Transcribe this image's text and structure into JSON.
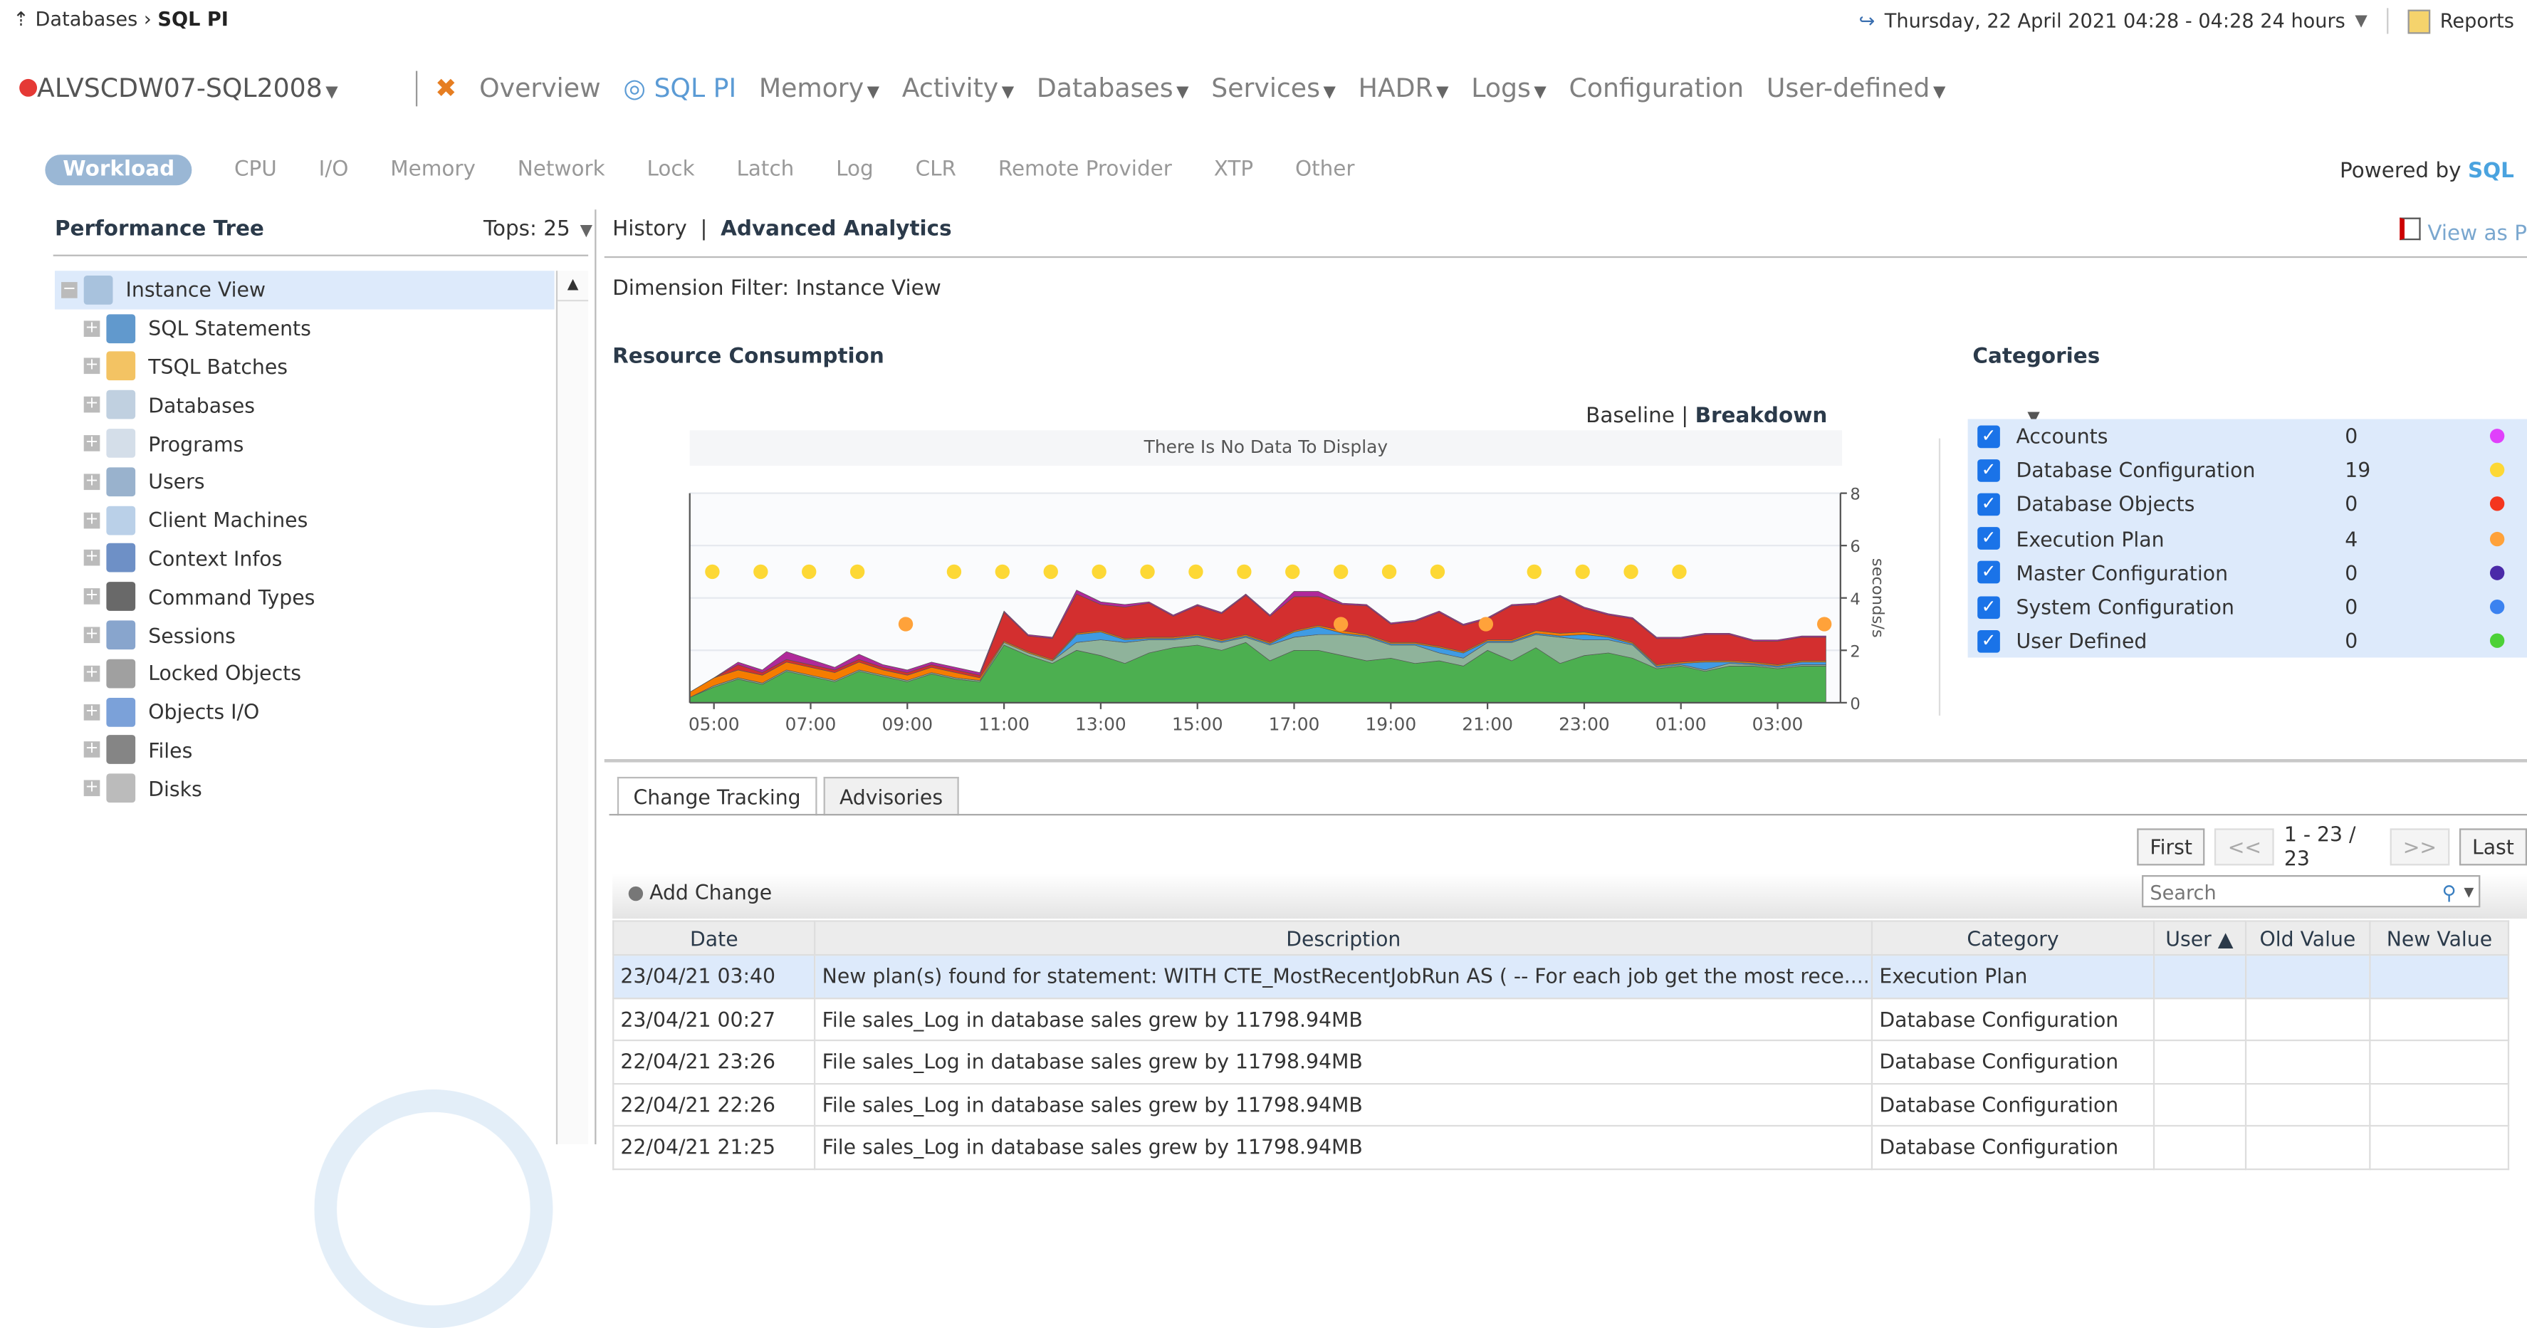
{
  "breadcrumb": {
    "parent": "Databases",
    "current": "SQL PI"
  },
  "time_range": "Thursday, 22 April 2021 04:28 - 04:28 24 hours",
  "reports_label": "Reports",
  "instance": {
    "name": "ALVSCDW07-SQL2008",
    "status": "error"
  },
  "nav": [
    {
      "label": "Overview",
      "caret": false
    },
    {
      "label": "SQL PI",
      "caret": false,
      "active": true
    },
    {
      "label": "Memory",
      "caret": true
    },
    {
      "label": "Activity",
      "caret": true
    },
    {
      "label": "Databases",
      "caret": true
    },
    {
      "label": "Services",
      "caret": true
    },
    {
      "label": "HADR",
      "caret": true
    },
    {
      "label": "Logs",
      "caret": true
    },
    {
      "label": "Configuration",
      "caret": false
    },
    {
      "label": "User-defined",
      "caret": true
    }
  ],
  "subnav": [
    "Workload",
    "CPU",
    "I/O",
    "Memory",
    "Network",
    "Lock",
    "Latch",
    "Log",
    "CLR",
    "Remote Provider",
    "XTP",
    "Other"
  ],
  "subnav_active": "Workload",
  "powered_by": {
    "prefix": "Powered by",
    "brand": "SQL"
  },
  "tree": {
    "title": "Performance Tree",
    "tops_label": "Tops:",
    "tops_value": "25",
    "items": [
      {
        "label": "Instance View",
        "icon": "instance-icon",
        "expanded": true
      },
      {
        "label": "SQL Statements",
        "icon": "sql-icon"
      },
      {
        "label": "TSQL Batches",
        "icon": "batches-icon"
      },
      {
        "label": "Databases",
        "icon": "database-icon"
      },
      {
        "label": "Programs",
        "icon": "programs-icon"
      },
      {
        "label": "Users",
        "icon": "users-icon"
      },
      {
        "label": "Client Machines",
        "icon": "client-machine-icon"
      },
      {
        "label": "Context Infos",
        "icon": "context-icon"
      },
      {
        "label": "Command Types",
        "icon": "command-icon"
      },
      {
        "label": "Sessions",
        "icon": "sessions-icon"
      },
      {
        "label": "Locked Objects",
        "icon": "lock-icon"
      },
      {
        "label": "Objects I/O",
        "icon": "objects-io-icon"
      },
      {
        "label": "Files",
        "icon": "files-icon"
      },
      {
        "label": "Disks",
        "icon": "disks-icon"
      }
    ]
  },
  "right_header": {
    "history": "History",
    "separator": "|",
    "advanced": "Advanced Analytics",
    "view_as": "View as P"
  },
  "dimension_filter": "Dimension Filter: Instance View",
  "resource_title": "Resource Consumption",
  "baseline": "Baseline",
  "breakdown": "Breakdown",
  "no_data": "There Is No Data To Display",
  "categories_title": "Categories",
  "categories": [
    {
      "name": "Accounts",
      "count": "0",
      "color": "#e040fb"
    },
    {
      "name": "Database Configuration",
      "count": "19",
      "color": "#fdd835"
    },
    {
      "name": "Database Objects",
      "count": "0",
      "color": "#f4361e"
    },
    {
      "name": "Execution Plan",
      "count": "4",
      "color": "#ffa23a"
    },
    {
      "name": "Master Configuration",
      "count": "0",
      "color": "#4a2aa8"
    },
    {
      "name": "System Configuration",
      "count": "0",
      "color": "#3b82f0"
    },
    {
      "name": "User Defined",
      "count": "0",
      "color": "#4cd137"
    }
  ],
  "chart_data": {
    "type": "area",
    "ylabel": "seconds/s",
    "ylim": [
      0,
      8
    ],
    "yticks": [
      "0",
      "2",
      "4",
      "6",
      "8"
    ],
    "xticks": [
      "05:00",
      "07:00",
      "09:00",
      "11:00",
      "13:00",
      "15:00",
      "17:00",
      "19:00",
      "21:00",
      "23:00",
      "01:00",
      "03:00"
    ],
    "x_hours": [
      4.5,
      5,
      5.5,
      6,
      6.5,
      7,
      7.5,
      8,
      8.5,
      9,
      9.5,
      10,
      10.5,
      11,
      11.5,
      12,
      12.5,
      13,
      13.5,
      14,
      14.5,
      15,
      15.5,
      16,
      16.5,
      17,
      17.5,
      18,
      18.5,
      19,
      19.5,
      20,
      20.5,
      21,
      21.5,
      22,
      22.5,
      23,
      23.5,
      24,
      24.5,
      25,
      25.5,
      26,
      26.5,
      27,
      27.5,
      28
    ],
    "series": [
      {
        "name": "green",
        "color": "#4caf50",
        "values": [
          0.2,
          0.6,
          0.9,
          0.7,
          1.2,
          1.0,
          0.8,
          1.2,
          1.0,
          0.8,
          1.1,
          0.9,
          0.8,
          2.2,
          1.8,
          1.5,
          2.0,
          1.8,
          1.5,
          1.9,
          2.1,
          2.2,
          2.0,
          2.3,
          1.6,
          2.0,
          2.0,
          1.8,
          1.6,
          1.7,
          1.5,
          1.6,
          1.4,
          2.0,
          1.6,
          2.1,
          1.5,
          1.8,
          1.9,
          1.7,
          1.3,
          1.4,
          1.2,
          1.4,
          1.4,
          1.3,
          1.4,
          1.4
        ]
      },
      {
        "name": "grey",
        "color": "#8fb39b",
        "values": [
          0,
          0.05,
          0.05,
          0.05,
          0.05,
          0.05,
          0.05,
          0.05,
          0.05,
          0.05,
          0.05,
          0.05,
          0.05,
          0.1,
          0.1,
          0.1,
          0.3,
          0.6,
          0.8,
          0.5,
          0.3,
          0.3,
          0.3,
          0.2,
          0.6,
          0.5,
          0.6,
          0.8,
          0.9,
          0.5,
          0.7,
          0.3,
          0.3,
          0.3,
          0.7,
          0.5,
          1.0,
          0.6,
          0.5,
          0.5,
          0.05,
          0.05,
          0.05,
          0.1,
          0.05,
          0.05,
          0.05,
          0.05
        ]
      },
      {
        "name": "blue",
        "color": "#3f9be3",
        "values": [
          0,
          0,
          0,
          0,
          0,
          0,
          0,
          0,
          0,
          0,
          0,
          0,
          0,
          0,
          0,
          0,
          0.3,
          0.3,
          0.1,
          0.05,
          0.05,
          0.05,
          0.05,
          0.05,
          0.05,
          0.2,
          0.3,
          0.05,
          0.05,
          0.05,
          0.05,
          0.2,
          0.2,
          0.05,
          0.05,
          0.05,
          0.05,
          0.2,
          0.1,
          0.05,
          0.05,
          0.05,
          0.3,
          0.05,
          0.05,
          0.05,
          0.1,
          0.1
        ]
      },
      {
        "name": "orange",
        "color": "#f57c00",
        "values": [
          0.2,
          0.3,
          0.3,
          0.3,
          0.3,
          0.3,
          0.3,
          0.3,
          0.2,
          0.2,
          0.2,
          0.2,
          0.1,
          0.05,
          0.05,
          0.05,
          0.05,
          0.05,
          0.05,
          0.05,
          0.05,
          0.05,
          0.05,
          0.05,
          0.05,
          0.05,
          0.05,
          0.1,
          0.05,
          0.05,
          0.05,
          0.05,
          0.05,
          0.05,
          0.05,
          0.1,
          0.1,
          0.1,
          0.05,
          0.05,
          0.05,
          0.05,
          0.05,
          0.05,
          0.05,
          0.05,
          0.05,
          0.05
        ]
      },
      {
        "name": "red",
        "color": "#d32f2f",
        "values": [
          0,
          0,
          0.2,
          0.1,
          0.1,
          0.1,
          0.1,
          0.1,
          0.1,
          0.1,
          0.1,
          0.1,
          0.1,
          1.1,
          0.6,
          0.8,
          1.5,
          1.0,
          1.2,
          1.3,
          0.8,
          1.1,
          1.0,
          1.5,
          1.0,
          1.3,
          1.1,
          1.0,
          1.1,
          0.7,
          0.8,
          1.3,
          1.0,
          0.8,
          1.3,
          1.0,
          1.4,
          0.9,
          0.8,
          0.9,
          1.0,
          0.9,
          1.0,
          1.0,
          0.8,
          0.9,
          0.9,
          0.9
        ]
      },
      {
        "name": "purple",
        "color": "#b0289a",
        "values": [
          0,
          0,
          0.1,
          0.1,
          0.3,
          0.2,
          0.1,
          0.2,
          0.1,
          0.1,
          0.1,
          0.1,
          0.1,
          0.05,
          0.05,
          0.05,
          0.15,
          0.1,
          0.1,
          0.05,
          0.05,
          0.05,
          0.05,
          0.05,
          0.05,
          0.2,
          0.2,
          0.05,
          0.05,
          0.05,
          0.05,
          0.05,
          0.05,
          0.05,
          0.05,
          0.05,
          0.05,
          0.05,
          0.05,
          0.05,
          0.05,
          0.05,
          0.05,
          0.05,
          0.05,
          0.05,
          0.05,
          0.05
        ]
      }
    ],
    "markers": [
      {
        "category": "Database Configuration",
        "color": "#fdd835",
        "y": 5,
        "x_hours": [
          4.5,
          5.5,
          6.5,
          7.5,
          9.5,
          10.5,
          11.5,
          12.5,
          13.5,
          14.5,
          15.5,
          16.5,
          17.5,
          18.5,
          19.5,
          21.5,
          22.5,
          23.5,
          24.5
        ]
      },
      {
        "category": "Execution Plan",
        "color": "#ffa23a",
        "y": 3,
        "x_hours": [
          8.5,
          17.5,
          20.5,
          27.5
        ]
      }
    ]
  },
  "bottom_tabs": [
    "Change Tracking",
    "Advisories"
  ],
  "pager": {
    "first": "First",
    "prev": "<<",
    "range": "1 - 23 / 23",
    "next": ">>",
    "last": "Last"
  },
  "add_change": "Add Change",
  "search_placeholder": "Search",
  "table": {
    "columns": [
      "Date",
      "Description",
      "Category",
      "User ▲",
      "Old Value",
      "New Value"
    ],
    "rows": [
      [
        "23/04/21 03:40",
        "New plan(s) found for statement: WITH CTE_MostRecentJobRun AS ( -- For each job get the most rece....",
        "Execution Plan",
        "",
        "",
        ""
      ],
      [
        "23/04/21 00:27",
        "File sales_Log in database sales grew by 11798.94MB",
        "Database Configuration",
        "",
        "",
        ""
      ],
      [
        "22/04/21 23:26",
        "File sales_Log in database sales grew by 11798.94MB",
        "Database Configuration",
        "",
        "",
        ""
      ],
      [
        "22/04/21 22:26",
        "File sales_Log in database sales grew by 11798.94MB",
        "Database Configuration",
        "",
        "",
        ""
      ],
      [
        "22/04/21 21:25",
        "File sales_Log in database sales grew by 11798.94MB",
        "Database Configuration",
        "",
        "",
        ""
      ]
    ]
  }
}
